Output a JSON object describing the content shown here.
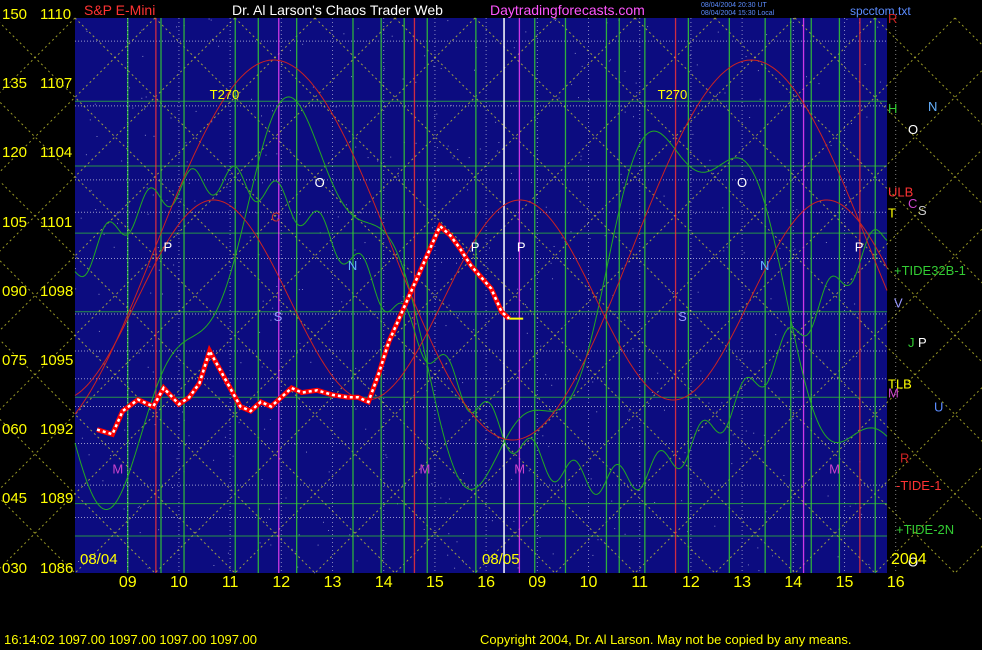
{
  "header": {
    "title_left": "S&P E-Mini",
    "title_main": "Dr. Al Larson's Chaos Trader Web",
    "site": "Daytradingforecasts.com",
    "time_line1": "08/04/2004 20:30 UT",
    "time_line2": "08/04/2004 15:30 Local",
    "file": "spcctom.txt"
  },
  "footer": {
    "readout": "16:14:02  1097.00 1097.00 1097.00 1097.00",
    "copyright": "Copyright 2004, Dr. Al Larson. May not be copied by any means."
  },
  "colors": {
    "plot_bg": "#0c0c80",
    "grid_green": "#33cc33",
    "price_white": "#ffffff",
    "price_red": "#ff0000",
    "flux_green": "#22aa22",
    "flux_red": "#cc2222",
    "yellow_dotted": "#cccc33"
  },
  "chart_data": {
    "type": "line",
    "title": "S&P E-Mini",
    "left_scale": [
      {
        "osc": "150",
        "price": "1110"
      },
      {
        "osc": "135",
        "price": "1107"
      },
      {
        "osc": "120",
        "price": "1104"
      },
      {
        "osc": "105",
        "price": "1101"
      },
      {
        "osc": "090",
        "price": "1098"
      },
      {
        "osc": "075",
        "price": "1095"
      },
      {
        "osc": "060",
        "price": "1092"
      },
      {
        "osc": "045",
        "price": "1089"
      },
      {
        "osc": "030",
        "price": "1086"
      }
    ],
    "ylim": [
      1086,
      1110
    ],
    "x_hours": [
      "09",
      "10",
      "11",
      "12",
      "13",
      "14",
      "15",
      "16",
      "09",
      "10",
      "11",
      "12",
      "13",
      "14",
      "15",
      "16"
    ],
    "xlim": [
      0,
      15.8
    ],
    "date_labels": [
      "08/04",
      "08/05"
    ],
    "year_label": "2004",
    "price_series": {
      "name": "S&P E-Mini 08/04",
      "points": [
        [
          0.0,
          1092.2
        ],
        [
          0.3,
          1092.0
        ],
        [
          0.5,
          1093.0
        ],
        [
          0.8,
          1093.5
        ],
        [
          1.1,
          1093.2
        ],
        [
          1.3,
          1094.0
        ],
        [
          1.6,
          1093.3
        ],
        [
          1.8,
          1093.6
        ],
        [
          2.0,
          1094.2
        ],
        [
          2.2,
          1095.6
        ],
        [
          2.4,
          1094.8
        ],
        [
          2.6,
          1094.0
        ],
        [
          2.8,
          1093.2
        ],
        [
          3.0,
          1093.0
        ],
        [
          3.2,
          1093.4
        ],
        [
          3.4,
          1093.2
        ],
        [
          3.6,
          1093.6
        ],
        [
          3.8,
          1094.0
        ],
        [
          4.0,
          1093.8
        ],
        [
          4.3,
          1093.9
        ],
        [
          4.6,
          1093.7
        ],
        [
          4.9,
          1093.6
        ],
        [
          5.1,
          1093.6
        ],
        [
          5.3,
          1093.4
        ],
        [
          5.5,
          1094.6
        ],
        [
          5.7,
          1096.0
        ],
        [
          5.9,
          1097.0
        ],
        [
          6.1,
          1098.0
        ],
        [
          6.3,
          1099.0
        ],
        [
          6.5,
          1100.0
        ],
        [
          6.7,
          1101.0
        ],
        [
          6.9,
          1100.6
        ],
        [
          7.1,
          1100.0
        ],
        [
          7.3,
          1099.3
        ],
        [
          7.5,
          1098.8
        ],
        [
          7.7,
          1098.3
        ],
        [
          7.9,
          1097.3
        ],
        [
          8.05,
          1097.0
        ]
      ]
    },
    "price_levels_dotted": [
      1109.0,
      1106.2,
      1103.0,
      1101.6,
      1099.6,
      1097.2,
      1095.6,
      1094.4,
      1093.2,
      1091.6,
      1089.8,
      1088.4
    ],
    "vertical_time_lines": [
      0.6,
      1.25,
      1.7,
      2.7,
      3.15,
      3.9,
      5.0,
      5.55,
      6.0,
      6.45,
      7.4,
      8.55,
      9.15,
      9.95,
      10.2,
      10.7,
      11.55,
      12.35,
      13.05,
      13.55,
      13.95,
      14.5,
      15.2
    ],
    "annotations_plot": [
      {
        "text": "T270",
        "x": 2.2,
        "price": 1106.5,
        "color": "#ffff00"
      },
      {
        "text": "T270",
        "x": 10.95,
        "price": 1106.5,
        "color": "#ffff00"
      },
      {
        "text": "O",
        "x": 4.25,
        "price": 1102.7,
        "color": "#ffffff"
      },
      {
        "text": "O",
        "x": 12.5,
        "price": 1102.7,
        "color": "#ffffff"
      },
      {
        "text": "P",
        "x": 1.3,
        "price": 1099.9,
        "color": "#ffffff"
      },
      {
        "text": "P",
        "x": 7.3,
        "price": 1099.9,
        "color": "#ffffff"
      },
      {
        "text": "P",
        "x": 8.2,
        "price": 1099.9,
        "color": "#ffffff"
      },
      {
        "text": "P",
        "x": 14.8,
        "price": 1099.9,
        "color": "#ffffff"
      },
      {
        "text": "N",
        "x": 4.9,
        "price": 1099.1,
        "color": "#66b2ff"
      },
      {
        "text": "N",
        "x": 12.95,
        "price": 1099.1,
        "color": "#66b2ff"
      },
      {
        "text": "C",
        "x": 3.4,
        "price": 1101.2,
        "color": "#cc3333"
      },
      {
        "text": "S",
        "x": 3.45,
        "price": 1096.9,
        "color": "#9999ff"
      },
      {
        "text": "S",
        "x": 11.35,
        "price": 1096.9,
        "color": "#9999ff"
      },
      {
        "text": "M",
        "x": 0.3,
        "price": 1090.3,
        "color": "#cc44cc"
      },
      {
        "text": "M",
        "x": 6.3,
        "price": 1090.3,
        "color": "#cc44cc"
      },
      {
        "text": "M",
        "x": 8.15,
        "price": 1090.3,
        "color": "#cc44cc"
      },
      {
        "text": "M",
        "x": 14.3,
        "price": 1090.3,
        "color": "#cc44cc"
      }
    ],
    "right_labels": [
      {
        "text": "R",
        "price": 1110.0,
        "color": "#cc2222",
        "col": 0
      },
      {
        "text": "H",
        "price": 1106.1,
        "color": "#33cc33",
        "col": 0
      },
      {
        "text": "N",
        "price": 1106.2,
        "color": "#66b2ff",
        "col": 2
      },
      {
        "text": "O",
        "price": 1105.2,
        "color": "#ffffff",
        "col": 1
      },
      {
        "text": "ULB",
        "price": 1102.5,
        "color": "#ff3333",
        "col": 0
      },
      {
        "text": "C",
        "price": 1102.0,
        "color": "#cc44cc",
        "col": 1
      },
      {
        "text": "S",
        "price": 1101.7,
        "color": "#cccccc",
        "col": 1.5
      },
      {
        "text": "T",
        "price": 1101.6,
        "color": "#ffff00",
        "col": 0
      },
      {
        "text": "+TIDE32B-1",
        "price": 1099.1,
        "color": "#33cc33",
        "col": 0.3
      },
      {
        "text": "V",
        "price": 1097.7,
        "color": "#9999ff",
        "col": 0.3
      },
      {
        "text": "J",
        "price": 1096.0,
        "color": "#33cc33",
        "col": 1
      },
      {
        "text": "P",
        "price": 1096.0,
        "color": "#ffffff",
        "col": 1.5
      },
      {
        "text": "TLB",
        "price": 1094.2,
        "color": "#ffff00",
        "col": 0
      },
      {
        "text": "M",
        "price": 1093.8,
        "color": "#cc44cc",
        "col": 0
      },
      {
        "text": "U",
        "price": 1093.2,
        "color": "#5b8cff",
        "col": 2.3
      },
      {
        "text": "R",
        "price": 1091.0,
        "color": "#cc2222",
        "col": 0.6
      },
      {
        "text": "-TIDE-1",
        "price": 1089.8,
        "color": "#ff3333",
        "col": 0.4
      },
      {
        "text": "+TIDE-2N",
        "price": 1087.9,
        "color": "#33cc33",
        "col": 0.4
      },
      {
        "text": "O",
        "price": 1086.5,
        "color": "#ffffff",
        "col": 1
      }
    ]
  }
}
